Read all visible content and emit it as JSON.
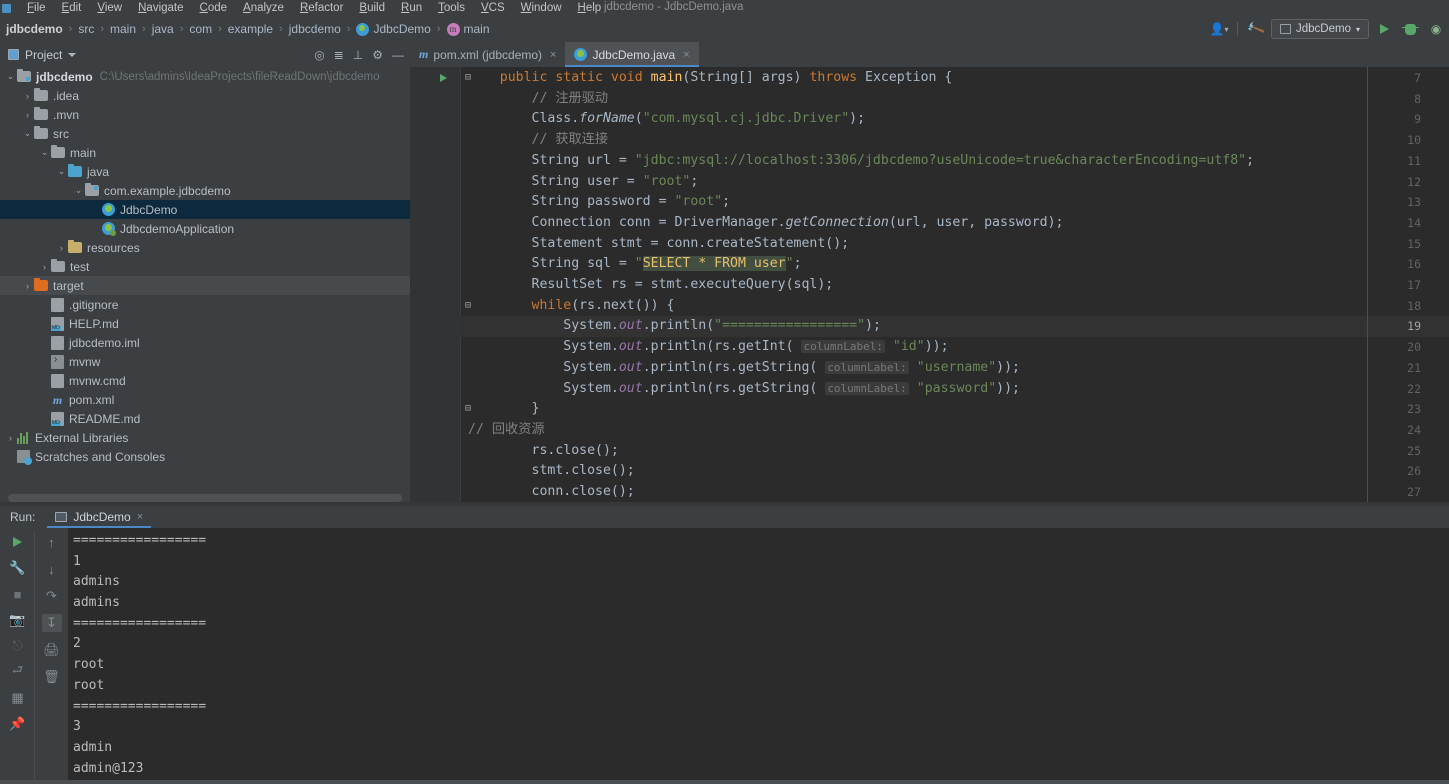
{
  "window": {
    "title": "jdbcdemo - JdbcDemo.java",
    "accent_blue": "#4A88C7",
    "bg_chrome": "#3C3F41",
    "bg_editor": "#2B2B2B"
  },
  "menu": {
    "items": [
      "File",
      "Edit",
      "View",
      "Navigate",
      "Code",
      "Analyze",
      "Refactor",
      "Build",
      "Run",
      "Tools",
      "VCS",
      "Window",
      "Help"
    ]
  },
  "breadcrumb": {
    "items": [
      {
        "label": "jdbcdemo",
        "icon": "none"
      },
      {
        "label": "src",
        "icon": "none"
      },
      {
        "label": "main",
        "icon": "none"
      },
      {
        "label": "java",
        "icon": "none"
      },
      {
        "label": "com",
        "icon": "none"
      },
      {
        "label": "example",
        "icon": "none"
      },
      {
        "label": "jdbcdemo",
        "icon": "none"
      },
      {
        "label": "JdbcDemo",
        "icon": "class-icon"
      },
      {
        "label": "main",
        "icon": "method-icon"
      }
    ],
    "separator": "›"
  },
  "toolbar": {
    "account_icon": "user-icon",
    "build_icon": "hammer-icon",
    "run_config": "JdbcDemo",
    "run_icon": "run-icon",
    "debug_icon": "debug-icon",
    "coverage_icon": "coverage-icon",
    "dropdown_caret": "▾"
  },
  "toolwindow": {
    "title": "Project",
    "caret": "▾",
    "actions": [
      "locate-icon",
      "expand-all-icon",
      "collapse-all-icon",
      "settings-icon",
      "hide-icon"
    ]
  },
  "editor_tabs": [
    {
      "label": "pom.xml (jdbcdemo)",
      "icon": "maven-icon",
      "active": false,
      "close": "×"
    },
    {
      "label": "JdbcDemo.java",
      "icon": "java-class-icon",
      "active": true,
      "close": "×"
    }
  ],
  "project_tree": [
    {
      "depth": 0,
      "arrow": "⌄",
      "icon": "module-folder",
      "label": "jdbcdemo",
      "bold": true,
      "path": "C:\\Users\\admins\\IdeaProjects\\fileReadDown\\jdbcdemo",
      "state": "normal"
    },
    {
      "depth": 1,
      "arrow": "›",
      "icon": "folder",
      "label": ".idea",
      "state": "normal"
    },
    {
      "depth": 1,
      "arrow": "›",
      "icon": "folder",
      "label": ".mvn",
      "state": "normal"
    },
    {
      "depth": 1,
      "arrow": "⌄",
      "icon": "folder",
      "label": "src",
      "state": "normal"
    },
    {
      "depth": 2,
      "arrow": "⌄",
      "icon": "folder",
      "label": "main",
      "state": "normal"
    },
    {
      "depth": 3,
      "arrow": "⌄",
      "icon": "source-folder",
      "label": "java",
      "state": "normal"
    },
    {
      "depth": 4,
      "arrow": "⌄",
      "icon": "package-folder",
      "label": "com.example.jdbcdemo",
      "state": "normal"
    },
    {
      "depth": 5,
      "arrow": "",
      "icon": "java-class-icon",
      "label": "JdbcDemo",
      "state": "selected"
    },
    {
      "depth": 5,
      "arrow": "",
      "icon": "spring-class-icon",
      "label": "JdbcdemoApplication",
      "state": "normal"
    },
    {
      "depth": 3,
      "arrow": "›",
      "icon": "resources-folder",
      "label": "resources",
      "state": "normal"
    },
    {
      "depth": 2,
      "arrow": "›",
      "icon": "folder",
      "label": "test",
      "state": "normal"
    },
    {
      "depth": 1,
      "arrow": "›",
      "icon": "target-folder",
      "label": "target",
      "state": "hover"
    },
    {
      "depth": 2,
      "arrow": "",
      "icon": "gitignore-icon",
      "label": ".gitignore",
      "state": "normal"
    },
    {
      "depth": 2,
      "arrow": "",
      "icon": "markdown-icon",
      "label": "HELP.md",
      "state": "normal"
    },
    {
      "depth": 2,
      "arrow": "",
      "icon": "iml-icon",
      "label": "jdbcdemo.iml",
      "state": "normal"
    },
    {
      "depth": 2,
      "arrow": "",
      "icon": "shell-icon",
      "label": "mvnw",
      "state": "normal"
    },
    {
      "depth": 2,
      "arrow": "",
      "icon": "cmd-icon",
      "label": "mvnw.cmd",
      "state": "normal"
    },
    {
      "depth": 2,
      "arrow": "",
      "icon": "maven-icon",
      "label": "pom.xml",
      "state": "normal"
    },
    {
      "depth": 2,
      "arrow": "",
      "icon": "markdown-icon",
      "label": "README.md",
      "state": "normal"
    },
    {
      "depth": 0,
      "arrow": "›",
      "icon": "libraries-icon",
      "label": "External Libraries",
      "state": "normal"
    },
    {
      "depth": 0,
      "arrow": "",
      "icon": "scratches-icon",
      "label": "Scratches and Consoles",
      "state": "normal"
    }
  ],
  "code": {
    "first_line_number": 7,
    "current_line": 19,
    "lines": [
      {
        "n": 7,
        "indent": 4,
        "runnable": true,
        "fold": "open",
        "tokens": [
          {
            "t": "public ",
            "c": "k"
          },
          {
            "t": "static ",
            "c": "k"
          },
          {
            "t": "void ",
            "c": "k"
          },
          {
            "t": "main",
            "c": "m"
          },
          {
            "t": "(String[] args) ",
            "c": "p"
          },
          {
            "t": "throws ",
            "c": "k"
          },
          {
            "t": "Exception {",
            "c": "p"
          }
        ]
      },
      {
        "n": 8,
        "indent": 8,
        "tokens": [
          {
            "t": "// 注册驱动",
            "c": "c"
          }
        ]
      },
      {
        "n": 9,
        "indent": 8,
        "tokens": [
          {
            "t": "Class.",
            "c": "p"
          },
          {
            "t": "forName",
            "c": "si"
          },
          {
            "t": "(",
            "c": "p"
          },
          {
            "t": "\"com.mysql.cj.jdbc.Driver\"",
            "c": "s"
          },
          {
            "t": ");",
            "c": "p"
          }
        ]
      },
      {
        "n": 10,
        "indent": 8,
        "tokens": [
          {
            "t": "// 获取连接",
            "c": "c"
          }
        ]
      },
      {
        "n": 11,
        "indent": 8,
        "tokens": [
          {
            "t": "String url = ",
            "c": "p"
          },
          {
            "t": "\"jdbc:mysql://localhost:3306/jdbcdemo?useUnicode=true&characterEncoding=utf8\"",
            "c": "s"
          },
          {
            "t": ";",
            "c": "p"
          }
        ]
      },
      {
        "n": 12,
        "indent": 8,
        "tokens": [
          {
            "t": "String user = ",
            "c": "p"
          },
          {
            "t": "\"root\"",
            "c": "s"
          },
          {
            "t": ";",
            "c": "p"
          }
        ]
      },
      {
        "n": 13,
        "indent": 8,
        "tokens": [
          {
            "t": "String password = ",
            "c": "p"
          },
          {
            "t": "\"root\"",
            "c": "s"
          },
          {
            "t": ";",
            "c": "p"
          }
        ]
      },
      {
        "n": 14,
        "indent": 8,
        "tokens": [
          {
            "t": "Connection conn = DriverManager.",
            "c": "p"
          },
          {
            "t": "getConnection",
            "c": "si"
          },
          {
            "t": "(url, user, password);",
            "c": "p"
          }
        ]
      },
      {
        "n": 15,
        "indent": 8,
        "tokens": [
          {
            "t": "Statement stmt = conn.createStatement();",
            "c": "p"
          }
        ]
      },
      {
        "n": 16,
        "indent": 8,
        "sql": true,
        "tokens": [
          {
            "t": "String sql = ",
            "c": "p"
          },
          {
            "t": "\"",
            "c": "s"
          },
          {
            "t": "SELECT * FROM user",
            "c": "sql"
          },
          {
            "t": "\"",
            "c": "s"
          },
          {
            "t": ";",
            "c": "p"
          }
        ]
      },
      {
        "n": 17,
        "indent": 8,
        "tokens": [
          {
            "t": "ResultSet rs = stmt.executeQuery(sql);",
            "c": "p"
          }
        ]
      },
      {
        "n": 18,
        "indent": 8,
        "fold": "close",
        "tokens": [
          {
            "t": "while",
            "c": "k"
          },
          {
            "t": "(rs.next()) {",
            "c": "p"
          }
        ]
      },
      {
        "n": 19,
        "indent": 12,
        "current": true,
        "tokens": [
          {
            "t": "System.",
            "c": "p"
          },
          {
            "t": "out",
            "c": "st"
          },
          {
            "t": ".println(",
            "c": "p"
          },
          {
            "t": "\"=================\"",
            "c": "s"
          },
          {
            "t": ");",
            "c": "p"
          }
        ]
      },
      {
        "n": 20,
        "indent": 12,
        "hint": "columnLabel:",
        "tokens": [
          {
            "t": "System.",
            "c": "p"
          },
          {
            "t": "out",
            "c": "st"
          },
          {
            "t": ".println(rs.getInt( ",
            "c": "p"
          },
          {
            "t": "columnLabel:",
            "c": "hint"
          },
          {
            "t": " ",
            "c": "p"
          },
          {
            "t": "\"id\"",
            "c": "s"
          },
          {
            "t": "));",
            "c": "p"
          }
        ]
      },
      {
        "n": 21,
        "indent": 12,
        "tokens": [
          {
            "t": "System.",
            "c": "p"
          },
          {
            "t": "out",
            "c": "st"
          },
          {
            "t": ".println(rs.getString( ",
            "c": "p"
          },
          {
            "t": "columnLabel:",
            "c": "hint"
          },
          {
            "t": " ",
            "c": "p"
          },
          {
            "t": "\"username\"",
            "c": "s"
          },
          {
            "t": "));",
            "c": "p"
          }
        ]
      },
      {
        "n": 22,
        "indent": 12,
        "tokens": [
          {
            "t": "System.",
            "c": "p"
          },
          {
            "t": "out",
            "c": "st"
          },
          {
            "t": ".println(rs.getString( ",
            "c": "p"
          },
          {
            "t": "columnLabel:",
            "c": "hint"
          },
          {
            "t": " ",
            "c": "p"
          },
          {
            "t": "\"password\"",
            "c": "s"
          },
          {
            "t": "));",
            "c": "p"
          }
        ]
      },
      {
        "n": 23,
        "indent": 8,
        "fold": "close",
        "tokens": [
          {
            "t": "}",
            "c": "p"
          }
        ]
      },
      {
        "n": 24,
        "indent": 0,
        "tokens": [
          {
            "t": "// 回收资源",
            "c": "c"
          }
        ]
      },
      {
        "n": 25,
        "indent": 8,
        "tokens": [
          {
            "t": "rs.close();",
            "c": "p"
          }
        ]
      },
      {
        "n": 26,
        "indent": 8,
        "tokens": [
          {
            "t": "stmt.close();",
            "c": "p"
          }
        ]
      },
      {
        "n": 27,
        "indent": 8,
        "tokens": [
          {
            "t": "conn.close();",
            "c": "p"
          }
        ]
      }
    ]
  },
  "run_panel": {
    "label": "Run:",
    "tab": "JdbcDemo",
    "tab_close": "×",
    "left_icons": [
      "rerun-icon",
      "settings-wrench-icon",
      "stop-icon",
      "camera-icon",
      "thread-dump-icon",
      "export-icon",
      "layout-icon",
      "pin-icon"
    ],
    "second_icons": [
      "scroll-up-icon",
      "scroll-down-icon",
      "soft-wrap-icon",
      "scroll-to-end-icon",
      "print-icon",
      "trash-icon"
    ],
    "console_output": [
      "=================",
      "1",
      "admins",
      "admins",
      "=================",
      "2",
      "root",
      "root",
      "=================",
      "3",
      "admin",
      "admin@123"
    ]
  }
}
